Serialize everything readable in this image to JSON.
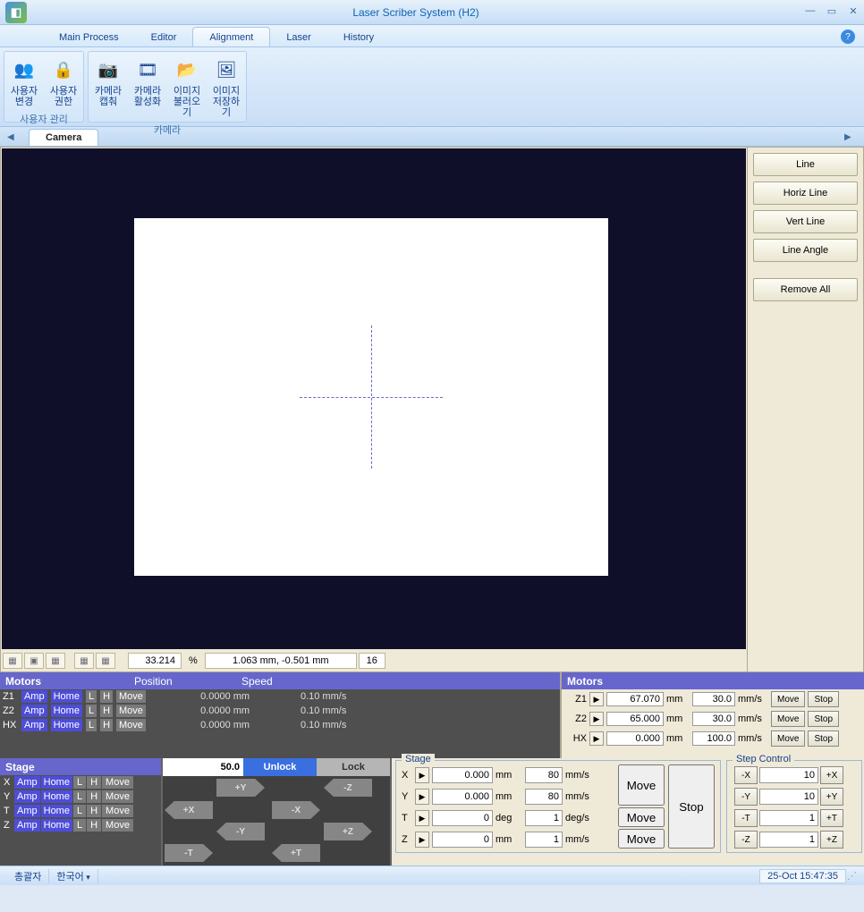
{
  "window": {
    "title": "Laser Scriber System (H2)"
  },
  "menu": {
    "tabs": [
      "Main Process",
      "Editor",
      "Alignment",
      "Laser",
      "History"
    ],
    "active": 2
  },
  "ribbon": {
    "groups": [
      {
        "label": "사용자 관리",
        "items": [
          {
            "text": "사용자\n변경",
            "icon": "👥"
          },
          {
            "text": "사용자\n권한",
            "icon": "🔒"
          }
        ]
      },
      {
        "label": "카메라",
        "items": [
          {
            "text": "카메라\n캡춰",
            "icon": "📷"
          },
          {
            "text": "카메라\n활성화",
            "icon": "🎞"
          },
          {
            "text": "이미지\n불러오기",
            "icon": "📂"
          },
          {
            "text": "이미지\n저장하기",
            "icon": "🖼"
          }
        ]
      }
    ]
  },
  "camera_tab": "Camera",
  "side_buttons": [
    "Line",
    "Horiz Line",
    "Vert Line",
    "Line Angle",
    "Remove All"
  ],
  "cam_status": {
    "zoom": "33.214",
    "zoom_unit": "%",
    "coords": "1.063 mm, -0.501 mm",
    "scale": "16"
  },
  "motors": {
    "header": "Motors",
    "col_pos": "Position",
    "col_spd": "Speed",
    "left_rows": [
      {
        "axis": "Z1",
        "pos": "0.0000 mm",
        "spd": "0.10 mm/s"
      },
      {
        "axis": "Z2",
        "pos": "0.0000 mm",
        "spd": "0.10 mm/s"
      },
      {
        "axis": "HX",
        "pos": "0.0000 mm",
        "spd": "0.10 mm/s"
      }
    ],
    "btns": {
      "amp": "Amp",
      "home": "Home",
      "l": "L",
      "h": "H",
      "move": "Move"
    },
    "right_rows": [
      {
        "axis": "Z1",
        "pos": "67.070",
        "spd": "30.0",
        "u1": "mm",
        "u2": "mm/s"
      },
      {
        "axis": "Z2",
        "pos": "65.000",
        "spd": "30.0",
        "u1": "mm",
        "u2": "mm/s"
      },
      {
        "axis": "HX",
        "pos": "0.000",
        "spd": "100.0",
        "u1": "mm",
        "u2": "mm/s"
      }
    ],
    "move_btn": "Move",
    "stop_btn": "Stop"
  },
  "stage": {
    "header": "Stage",
    "rows": [
      "X",
      "Y",
      "T",
      "Z"
    ],
    "jog_val": "50.0",
    "jog_unlock": "Unlock",
    "jog_lock": "Lock",
    "jog_labels": {
      "py": "+Y",
      "ny": "-Y",
      "px": "+X",
      "nx": "-X",
      "pz": "+Z",
      "nz": "-Z",
      "pt": "+T",
      "nt": "-T"
    }
  },
  "stage_box": {
    "legend": "Stage",
    "rows": [
      {
        "ax": "X",
        "pos": "0.000",
        "u1": "mm",
        "spd": "80",
        "u2": "mm/s"
      },
      {
        "ax": "Y",
        "pos": "0.000",
        "u1": "mm",
        "spd": "80",
        "u2": "mm/s"
      },
      {
        "ax": "T",
        "pos": "0",
        "u1": "deg",
        "spd": "1",
        "u2": "deg/s"
      },
      {
        "ax": "Z",
        "pos": "0",
        "u1": "mm",
        "spd": "1",
        "u2": "mm/s"
      }
    ],
    "move": "Move",
    "stop": "Stop"
  },
  "step": {
    "legend": "Step Control",
    "rows": [
      {
        "neg": "-X",
        "val": "10",
        "pos": "+X"
      },
      {
        "neg": "-Y",
        "val": "10",
        "pos": "+Y"
      },
      {
        "neg": "-T",
        "val": "1",
        "pos": "+T"
      },
      {
        "neg": "-Z",
        "val": "1",
        "pos": "+Z"
      }
    ]
  },
  "statusbar": {
    "left": "총괄자",
    "lang": "한국어",
    "time": "25-Oct 15:47:35"
  }
}
